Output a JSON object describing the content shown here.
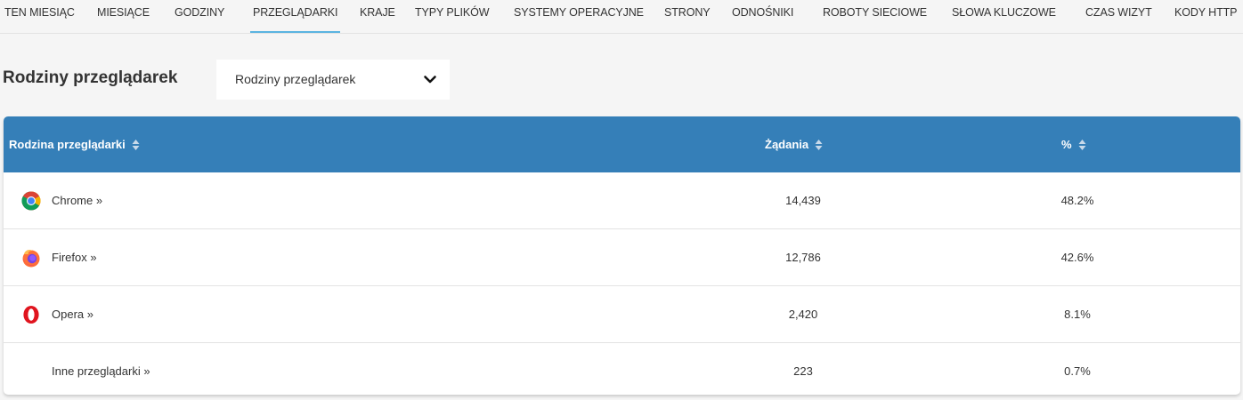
{
  "nav": {
    "tabs": [
      {
        "label": "TEN MIESIĄC"
      },
      {
        "label": "MIESIĄCE"
      },
      {
        "label": "GODZINY"
      },
      {
        "label": "PRZEGLĄDARKI",
        "active": true
      },
      {
        "label": "KRAJE"
      },
      {
        "label": "TYPY PLIKÓW"
      },
      {
        "label": "SYSTEMY OPERACYJNE"
      },
      {
        "label": "STRONY"
      },
      {
        "label": "ODNOŚNIKI"
      },
      {
        "label": "ROBOTY SIECIOWE"
      },
      {
        "label": "SŁOWA KLUCZOWE"
      },
      {
        "label": "CZAS WIZYT"
      },
      {
        "label": "KODY HTTP"
      }
    ],
    "active_color": "#5ab4e1"
  },
  "section": {
    "title": "Rodziny przeglądarek",
    "select_value": "Rodziny przeglądarek"
  },
  "table": {
    "header_color": "#357fb8",
    "columns": {
      "family": "Rodzina przeglądarki",
      "requests": "Żądania",
      "percent": "%"
    },
    "rows": [
      {
        "name": "Chrome »",
        "icon": "chrome-icon",
        "requests": "14,439",
        "percent": "48.2%"
      },
      {
        "name": "Firefox »",
        "icon": "firefox-icon",
        "requests": "12,786",
        "percent": "42.6%"
      },
      {
        "name": "Opera »",
        "icon": "opera-icon",
        "requests": "2,420",
        "percent": "8.1%"
      },
      {
        "name": "Inne przeglądarki »",
        "icon": "",
        "requests": "223",
        "percent": "0.7%"
      }
    ]
  }
}
